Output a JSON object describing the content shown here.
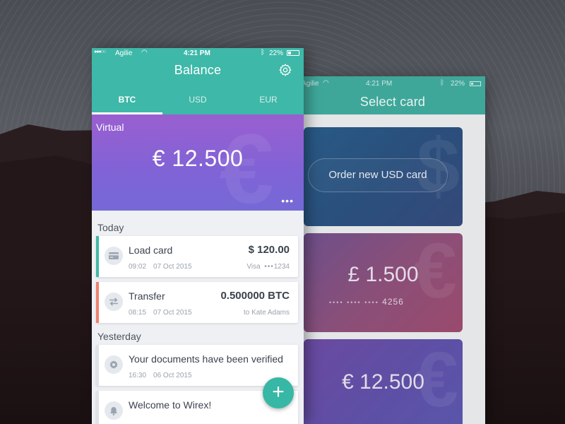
{
  "front": {
    "status": {
      "carrier": "Agilie",
      "time": "4:21 PM",
      "battery": "22%"
    },
    "title": "Balance",
    "tabs": [
      {
        "label": "BTC",
        "active": true
      },
      {
        "label": "USD",
        "active": false
      },
      {
        "label": "EUR",
        "active": false
      }
    ],
    "balance_card": {
      "label": "Virtual",
      "amount": "€ 12.500",
      "more": "•••"
    },
    "sections": {
      "today": "Today",
      "yesterday": "Yesterday"
    },
    "transactions": [
      {
        "name": "Load card",
        "time": "09:02",
        "date": "07 Oct 2015",
        "amount": "$ 120.00",
        "sub_prefix": "Visa",
        "sub_dots": "•••",
        "sub_suffix": "1234",
        "icon": "credit-card-icon",
        "stripe": "#3fb8a6"
      },
      {
        "name": "Transfer",
        "time": "08:15",
        "date": "07 Oct 2015",
        "amount": "0.500000 BTC",
        "sub": "to Kate Adams",
        "icon": "transfer-arrows-icon",
        "stripe": "#f0806e"
      }
    ],
    "notifications": [
      {
        "name": "Your documents have been verified",
        "time": "16:30",
        "date": "06 Oct 2015",
        "icon": "gear-icon"
      },
      {
        "name": "Welcome to Wirex!",
        "icon": "bell-icon"
      }
    ],
    "fab": "+"
  },
  "back": {
    "status": {
      "carrier": "Agilie",
      "time": "4:21 PM",
      "battery": "22%"
    },
    "title": "Select card",
    "cards": [
      {
        "button": "Order new USD card",
        "watermark": "$"
      },
      {
        "amount": "£ 1.500",
        "dots": "•••• •••• ••••",
        "last4": "4256",
        "watermark": "€"
      },
      {
        "amount": "€ 12.500",
        "watermark": "€"
      }
    ]
  },
  "colors": {
    "accent": "#3eb8a8",
    "balance_card": "#8a61d4",
    "load_stripe": "#3fb8a6",
    "transfer_stripe": "#f0806e"
  }
}
